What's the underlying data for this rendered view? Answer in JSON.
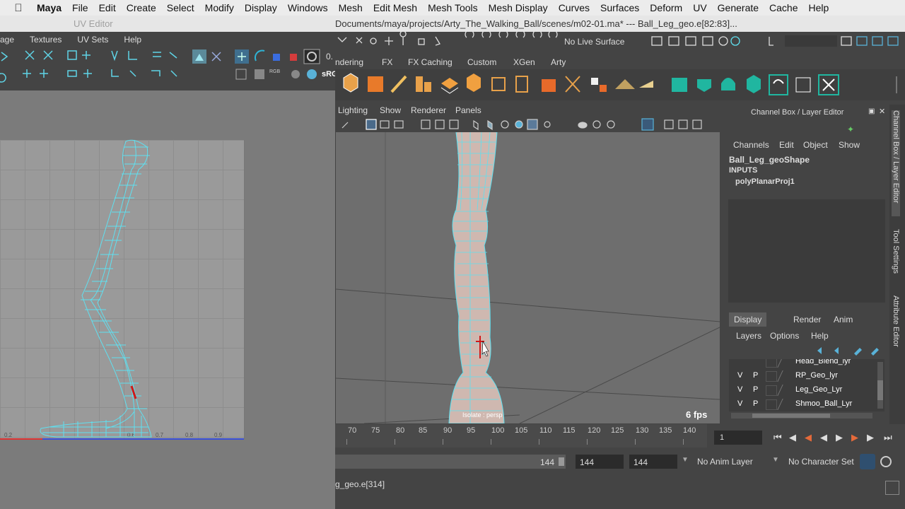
{
  "menubar": {
    "app": "Maya",
    "items": [
      "File",
      "Edit",
      "Create",
      "Select",
      "Modify",
      "Display",
      "Windows",
      "Mesh",
      "Edit Mesh",
      "Mesh Tools",
      "Mesh Display",
      "Curves",
      "Surfaces",
      "Deform",
      "UV",
      "Generate",
      "Cache",
      "Help"
    ]
  },
  "uv_editor": {
    "title": "UV Editor",
    "menu": [
      "age",
      "Textures",
      "UV Sets",
      "Help"
    ],
    "toolbar_value": "0.",
    "colorspace": "sRG",
    "ticks": [
      "0.2",
      "0.6",
      "0.7",
      "0.8",
      "0.9"
    ]
  },
  "main": {
    "title": "Documents/maya/projects/Arty_The_Walking_Ball/scenes/m02-01.ma*   ---   Ball_Leg_geo.e[82:83]...",
    "live_surface": "No Live Surface",
    "shelf_tabs": [
      "ndering",
      "FX",
      "FX Caching",
      "Custom",
      "XGen",
      "Arty"
    ],
    "panel_menu": [
      "Lighting",
      "Show",
      "Renderer",
      "Panels"
    ],
    "viewport": {
      "fps": "6 fps",
      "camera_label": "Isolate : persp"
    }
  },
  "channel_box": {
    "title": "Channel Box / Layer Editor",
    "menu": [
      "Channels",
      "Edit",
      "Object",
      "Show"
    ],
    "object": "Ball_Leg_geoShape",
    "inputs_label": "INPUTS",
    "inputs": [
      "polyPlanarProj1"
    ]
  },
  "layer_editor": {
    "tabs": [
      "Display",
      "Render",
      "Anim"
    ],
    "menu": [
      "Layers",
      "Options",
      "Help"
    ],
    "layers": [
      {
        "v": "",
        "p": "",
        "name": "Head_Blend_lyr"
      },
      {
        "v": "V",
        "p": "P",
        "name": "RP_Geo_lyr"
      },
      {
        "v": "V",
        "p": "P",
        "name": "Leg_Geo_Lyr"
      },
      {
        "v": "V",
        "p": "P",
        "name": "Shmoo_Ball_Lyr"
      }
    ]
  },
  "side_tabs": [
    "Channel Box / Layer Editor",
    "Tool Settings",
    "Attribute Editor"
  ],
  "time_slider": {
    "ticks": [
      "70",
      "75",
      "80",
      "85",
      "90",
      "95",
      "100",
      "105",
      "110",
      "115",
      "120",
      "125",
      "130",
      "135",
      "140"
    ],
    "current_frame": "1"
  },
  "range_slider": {
    "range_end_a": "144",
    "range_end_b": "144",
    "playback_end": "144",
    "anim_layer": "No Anim Layer",
    "character_set": "No Character Set"
  },
  "help_line": "g_geo.e[314]",
  "colors": {
    "wireframe": "#5fe0f0",
    "selection_red": "#d01818",
    "menubar_bg": "#ececec",
    "panel_bg": "#444444"
  }
}
